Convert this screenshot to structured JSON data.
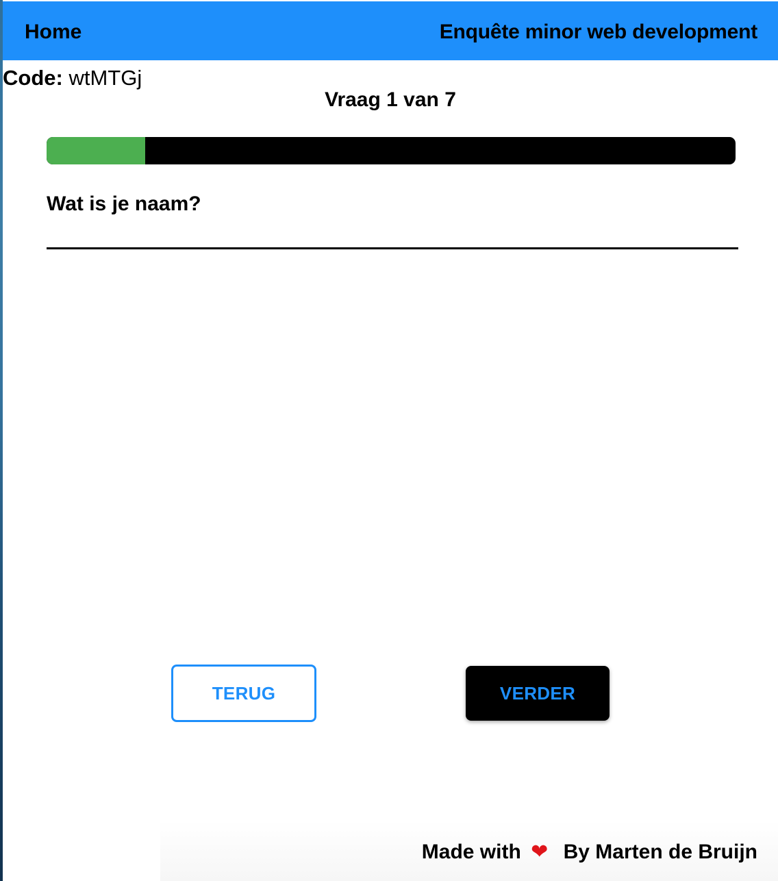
{
  "nav": {
    "home": "Home",
    "title": "Enquête minor web development"
  },
  "code": {
    "label": "Code:",
    "value": "wtMTGj"
  },
  "survey": {
    "counter": "Vraag 1 van 7",
    "current_question": 1,
    "total_questions": 7,
    "progress_fraction": 0.143,
    "question": "Wat is je naam?",
    "answer_value": "",
    "answer_placeholder": ""
  },
  "buttons": {
    "back": "TERUG",
    "next": "VERDER"
  },
  "footer": {
    "made_with": "Made with",
    "heart_icon": "heart-icon",
    "by": "By Marten de Bruijn"
  },
  "colors": {
    "accent": "#1e8ffb",
    "progress_fill": "#4caf50",
    "progress_track": "#000000",
    "heart": "#e0151b"
  }
}
